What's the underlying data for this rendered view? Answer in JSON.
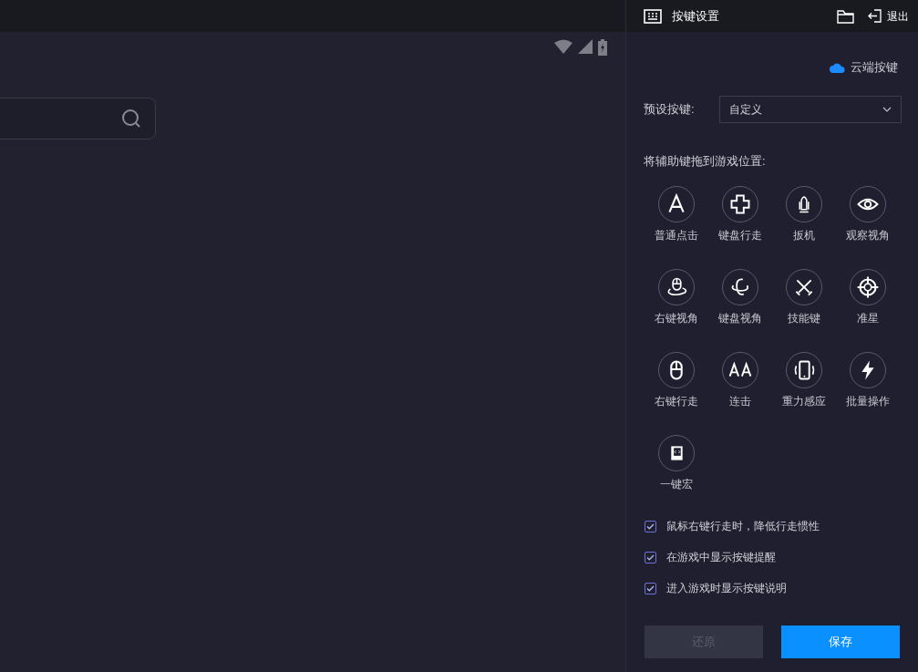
{
  "header": {
    "title": "按键设置",
    "exit_label": "退出"
  },
  "cloud_keys": {
    "label": "云端按键"
  },
  "preset": {
    "label": "预设按键:",
    "value": "自定义"
  },
  "drag_hint": "将辅助键拖到游戏位置:",
  "tools": [
    {
      "kind": "tap",
      "label": "普通点击"
    },
    {
      "kind": "dpad",
      "label": "键盘行走"
    },
    {
      "kind": "trigger",
      "label": "扳机"
    },
    {
      "kind": "eye",
      "label": "观察视角"
    },
    {
      "kind": "mouse-orbit",
      "label": "右键视角"
    },
    {
      "kind": "orbit",
      "label": "键盘视角"
    },
    {
      "kind": "swords",
      "label": "技能键"
    },
    {
      "kind": "crosshair",
      "label": "准星"
    },
    {
      "kind": "mouse",
      "label": "右键行走"
    },
    {
      "kind": "combo",
      "label": "连击"
    },
    {
      "kind": "phone",
      "label": "重力感应"
    },
    {
      "kind": "bolt",
      "label": "批量操作"
    },
    {
      "kind": "macro",
      "label": "一键宏"
    }
  ],
  "options": [
    {
      "label": "鼠标右键行走时，降低行走惯性",
      "checked": true
    },
    {
      "label": "在游戏中显示按键提醒",
      "checked": true
    },
    {
      "label": "进入游戏时显示按键说明",
      "checked": true
    }
  ],
  "buttons": [
    {
      "label": "还原",
      "disabled": true
    },
    {
      "label": "保存",
      "disabled": false
    }
  ]
}
